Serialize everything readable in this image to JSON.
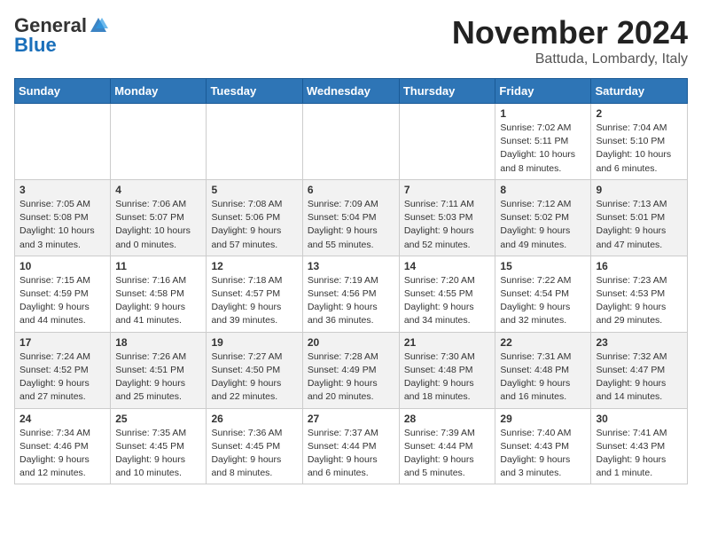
{
  "logo": {
    "line1": "General",
    "line2": "Blue"
  },
  "title": "November 2024",
  "subtitle": "Battuda, Lombardy, Italy",
  "days_of_week": [
    "Sunday",
    "Monday",
    "Tuesday",
    "Wednesday",
    "Thursday",
    "Friday",
    "Saturday"
  ],
  "weeks": [
    [
      {
        "day": "",
        "info": ""
      },
      {
        "day": "",
        "info": ""
      },
      {
        "day": "",
        "info": ""
      },
      {
        "day": "",
        "info": ""
      },
      {
        "day": "",
        "info": ""
      },
      {
        "day": "1",
        "info": "Sunrise: 7:02 AM\nSunset: 5:11 PM\nDaylight: 10 hours\nand 8 minutes."
      },
      {
        "day": "2",
        "info": "Sunrise: 7:04 AM\nSunset: 5:10 PM\nDaylight: 10 hours\nand 6 minutes."
      }
    ],
    [
      {
        "day": "3",
        "info": "Sunrise: 7:05 AM\nSunset: 5:08 PM\nDaylight: 10 hours\nand 3 minutes."
      },
      {
        "day": "4",
        "info": "Sunrise: 7:06 AM\nSunset: 5:07 PM\nDaylight: 10 hours\nand 0 minutes."
      },
      {
        "day": "5",
        "info": "Sunrise: 7:08 AM\nSunset: 5:06 PM\nDaylight: 9 hours\nand 57 minutes."
      },
      {
        "day": "6",
        "info": "Sunrise: 7:09 AM\nSunset: 5:04 PM\nDaylight: 9 hours\nand 55 minutes."
      },
      {
        "day": "7",
        "info": "Sunrise: 7:11 AM\nSunset: 5:03 PM\nDaylight: 9 hours\nand 52 minutes."
      },
      {
        "day": "8",
        "info": "Sunrise: 7:12 AM\nSunset: 5:02 PM\nDaylight: 9 hours\nand 49 minutes."
      },
      {
        "day": "9",
        "info": "Sunrise: 7:13 AM\nSunset: 5:01 PM\nDaylight: 9 hours\nand 47 minutes."
      }
    ],
    [
      {
        "day": "10",
        "info": "Sunrise: 7:15 AM\nSunset: 4:59 PM\nDaylight: 9 hours\nand 44 minutes."
      },
      {
        "day": "11",
        "info": "Sunrise: 7:16 AM\nSunset: 4:58 PM\nDaylight: 9 hours\nand 41 minutes."
      },
      {
        "day": "12",
        "info": "Sunrise: 7:18 AM\nSunset: 4:57 PM\nDaylight: 9 hours\nand 39 minutes."
      },
      {
        "day": "13",
        "info": "Sunrise: 7:19 AM\nSunset: 4:56 PM\nDaylight: 9 hours\nand 36 minutes."
      },
      {
        "day": "14",
        "info": "Sunrise: 7:20 AM\nSunset: 4:55 PM\nDaylight: 9 hours\nand 34 minutes."
      },
      {
        "day": "15",
        "info": "Sunrise: 7:22 AM\nSunset: 4:54 PM\nDaylight: 9 hours\nand 32 minutes."
      },
      {
        "day": "16",
        "info": "Sunrise: 7:23 AM\nSunset: 4:53 PM\nDaylight: 9 hours\nand 29 minutes."
      }
    ],
    [
      {
        "day": "17",
        "info": "Sunrise: 7:24 AM\nSunset: 4:52 PM\nDaylight: 9 hours\nand 27 minutes."
      },
      {
        "day": "18",
        "info": "Sunrise: 7:26 AM\nSunset: 4:51 PM\nDaylight: 9 hours\nand 25 minutes."
      },
      {
        "day": "19",
        "info": "Sunrise: 7:27 AM\nSunset: 4:50 PM\nDaylight: 9 hours\nand 22 minutes."
      },
      {
        "day": "20",
        "info": "Sunrise: 7:28 AM\nSunset: 4:49 PM\nDaylight: 9 hours\nand 20 minutes."
      },
      {
        "day": "21",
        "info": "Sunrise: 7:30 AM\nSunset: 4:48 PM\nDaylight: 9 hours\nand 18 minutes."
      },
      {
        "day": "22",
        "info": "Sunrise: 7:31 AM\nSunset: 4:48 PM\nDaylight: 9 hours\nand 16 minutes."
      },
      {
        "day": "23",
        "info": "Sunrise: 7:32 AM\nSunset: 4:47 PM\nDaylight: 9 hours\nand 14 minutes."
      }
    ],
    [
      {
        "day": "24",
        "info": "Sunrise: 7:34 AM\nSunset: 4:46 PM\nDaylight: 9 hours\nand 12 minutes."
      },
      {
        "day": "25",
        "info": "Sunrise: 7:35 AM\nSunset: 4:45 PM\nDaylight: 9 hours\nand 10 minutes."
      },
      {
        "day": "26",
        "info": "Sunrise: 7:36 AM\nSunset: 4:45 PM\nDaylight: 9 hours\nand 8 minutes."
      },
      {
        "day": "27",
        "info": "Sunrise: 7:37 AM\nSunset: 4:44 PM\nDaylight: 9 hours\nand 6 minutes."
      },
      {
        "day": "28",
        "info": "Sunrise: 7:39 AM\nSunset: 4:44 PM\nDaylight: 9 hours\nand 5 minutes."
      },
      {
        "day": "29",
        "info": "Sunrise: 7:40 AM\nSunset: 4:43 PM\nDaylight: 9 hours\nand 3 minutes."
      },
      {
        "day": "30",
        "info": "Sunrise: 7:41 AM\nSunset: 4:43 PM\nDaylight: 9 hours\nand 1 minute."
      }
    ]
  ]
}
